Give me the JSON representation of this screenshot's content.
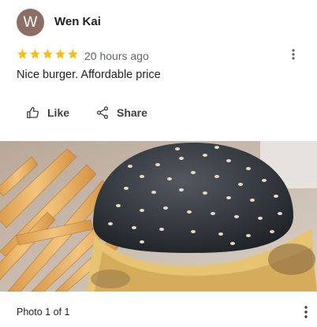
{
  "review": {
    "avatar_initial": "W",
    "reviewer_name": "Wen Kai",
    "rating": 5,
    "time_ago": "20 hours ago",
    "text": "Nice burger. Affordable price"
  },
  "actions": {
    "like_label": "Like",
    "share_label": "Share"
  },
  "photo": {
    "counter": "Photo 1 of 1"
  },
  "colors": {
    "avatar_bg": "#8d6e63",
    "star": "#fbbc04",
    "secondary_text": "#5f6368"
  },
  "icons": [
    "star-icon",
    "more-vert-icon",
    "thumb-up-icon",
    "share-icon"
  ]
}
